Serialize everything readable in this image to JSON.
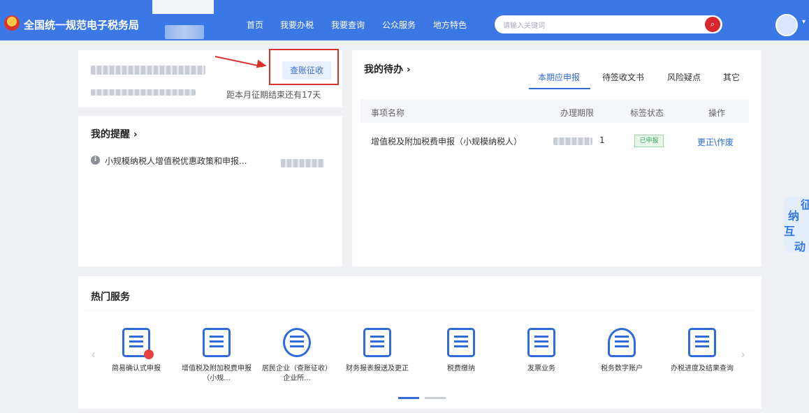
{
  "header": {
    "site_title": "全国统一规范电子税务局",
    "nav": [
      "首页",
      "我要办税",
      "我要查询",
      "公众服务",
      "地方特色"
    ],
    "search_placeholder": "请输入关键词"
  },
  "taxpayer": {
    "action_label": "查账征收",
    "deadline_text": "距本月征期结束还有17天"
  },
  "reminders": {
    "title": "我的提醒",
    "chevron": "›",
    "items": [
      "小规模纳税人增值税优惠政策和申报..."
    ]
  },
  "todo": {
    "title": "我的待办",
    "chevron": "›",
    "tabs": [
      "本期应申报",
      "待签收文书",
      "风险疑点",
      "其它"
    ],
    "columns": [
      "事项名称",
      "办理期限",
      "标签状态",
      "操作"
    ],
    "rows": [
      {
        "name": "增值税及附加税费申报（小规模纳税人）",
        "deadline_suffix": "1",
        "status": "已申报",
        "action": "更正\\作废"
      }
    ]
  },
  "hot_services": {
    "title": "热门服务",
    "items": [
      {
        "label": "简易确认式申报",
        "icon": "scroll-icon"
      },
      {
        "label": "增值税及附加税费申报（小规...",
        "icon": "doc-person-icon"
      },
      {
        "label": "居民企业（查账征收）企业所...",
        "icon": "enterprise-icon"
      },
      {
        "label": "财务报表报送及更正",
        "icon": "yuan-screen-icon"
      },
      {
        "label": "税费缴纳",
        "icon": "yuan-hand-icon"
      },
      {
        "label": "发票业务",
        "icon": "invoice-icon"
      },
      {
        "label": "税务数字账户",
        "icon": "person-123-icon"
      },
      {
        "label": "办税进度及结果查询",
        "icon": "doc-search-icon"
      }
    ]
  },
  "float_tab": {
    "chars": [
      "征",
      "纳",
      "互",
      "动"
    ]
  },
  "colors": {
    "primary": "#3b78e6",
    "accent": "#2f6bd8",
    "alert": "#d7312c"
  }
}
